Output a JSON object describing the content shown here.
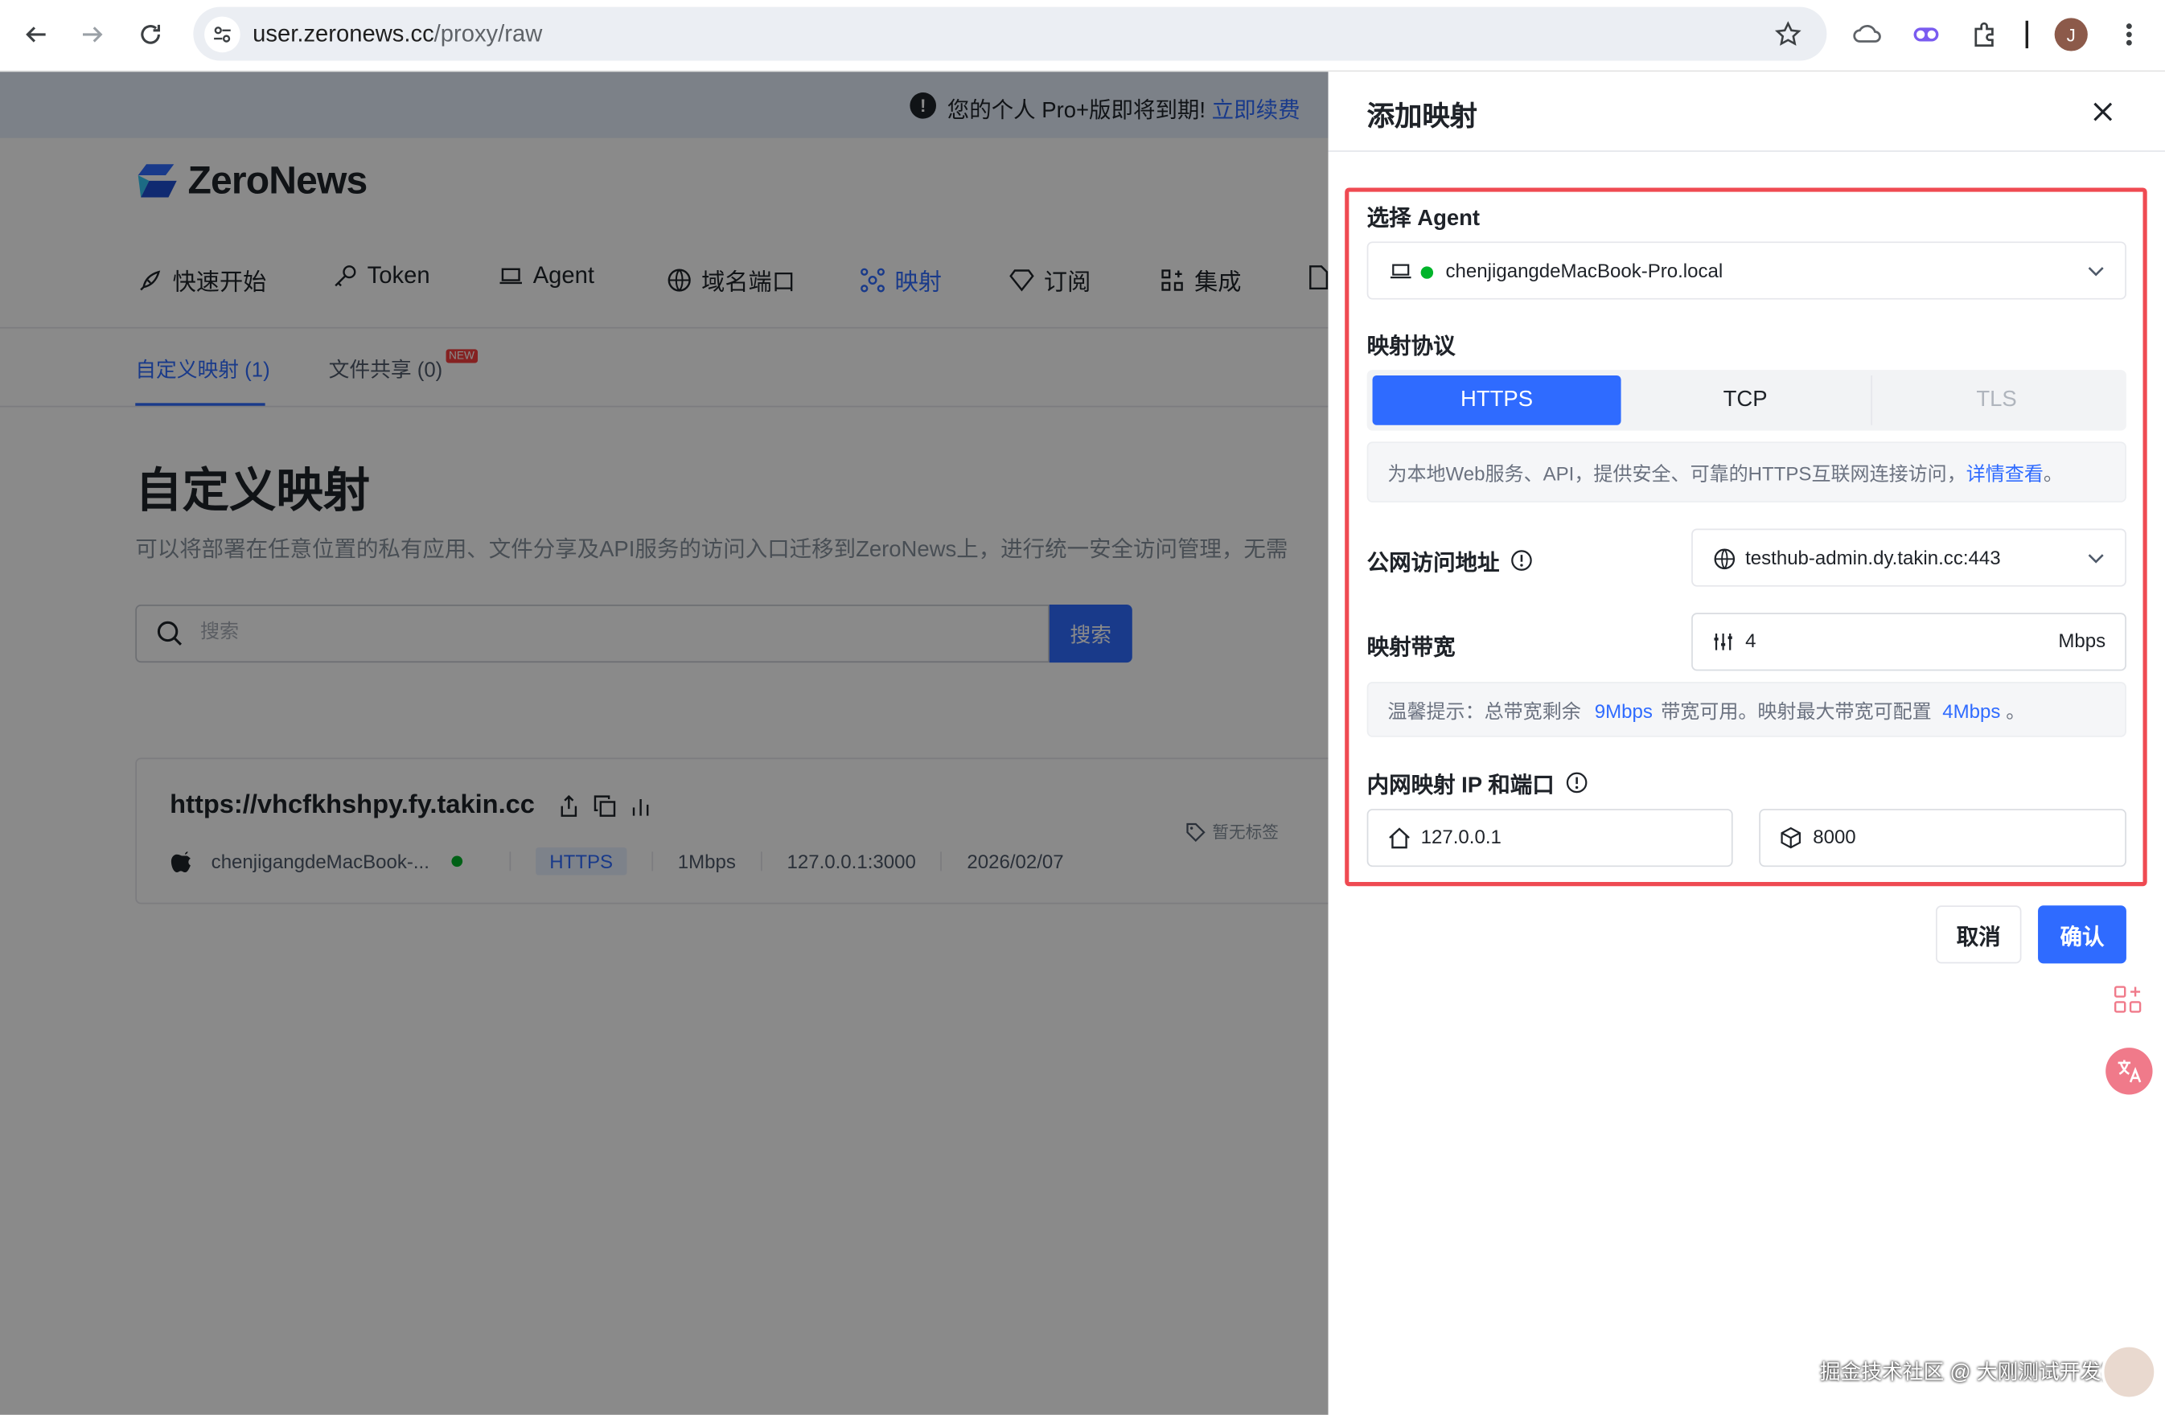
{
  "browser": {
    "url_host": "user.zeronews.cc",
    "url_path": "/proxy/raw",
    "profile_initial": "J"
  },
  "banner": {
    "message": "您的个人 Pro+版即将到期!",
    "renew_link": "立即续费"
  },
  "app": {
    "logo_text": "ZeroNews",
    "nav": [
      {
        "label": "快速开始",
        "icon": "rocket-icon"
      },
      {
        "label": "Token",
        "icon": "key-icon"
      },
      {
        "label": "Agent",
        "icon": "laptop-icon"
      },
      {
        "label": "域名端口",
        "icon": "globe-icon"
      },
      {
        "label": "映射",
        "icon": "network-icon",
        "active": true
      },
      {
        "label": "订阅",
        "icon": "diamond-icon"
      },
      {
        "label": "集成",
        "icon": "apps-icon"
      }
    ],
    "subtabs": [
      {
        "label": "自定义映射 (1)",
        "active": true
      },
      {
        "label": "文件共享 (0)",
        "badge": "NEW"
      }
    ],
    "page_title": "自定义映射",
    "page_desc": "可以将部署在任意位置的私有应用、文件分享及API服务的访问入口迁移到ZeroNews上，进行统一安全访问管理，无需",
    "search": {
      "placeholder": "搜索",
      "button": "搜索"
    },
    "card": {
      "url": "https://vhcfkhshpy.fy.takin.cc",
      "agent": "chenjigangdeMacBook-...",
      "protocol": "HTTPS",
      "bandwidth": "1Mbps",
      "local": "127.0.0.1:3000",
      "date": "2026/02/07",
      "tag": "暂无标签"
    }
  },
  "drawer": {
    "title": "添加映射",
    "agent_label": "选择 Agent",
    "agent_value": "chenjigangdeMacBook-Pro.local",
    "protocol_label": "映射协议",
    "protocols": [
      "HTTPS",
      "TCP",
      "TLS"
    ],
    "protocol_selected": "HTTPS",
    "protocol_info": "为本地Web服务、API，提供安全、可靠的HTTPS互联网连接访问，",
    "protocol_info_link": "详情查看",
    "protocol_info_end": "。",
    "public_label": "公网访问地址",
    "public_value": "testhub-admin.dy.takin.cc:443",
    "bandwidth_label": "映射带宽",
    "bandwidth_value": "4",
    "bandwidth_unit": "Mbps",
    "tip_prefix": "温馨提示：总带宽剩余",
    "tip_remaining": "9Mbps",
    "tip_mid": "带宽可用。映射最大带宽可配置",
    "tip_max": "4Mbps",
    "tip_end": "。",
    "local_label": "内网映射 IP 和端口",
    "local_ip": "127.0.0.1",
    "local_port": "8000",
    "cancel": "取消",
    "confirm": "确认"
  },
  "watermark": "掘金技术社区 @ 大刚测试开发实战",
  "colors": {
    "accent": "#2f6bff",
    "highlight": "#ef4a52",
    "online": "#00b42a"
  }
}
